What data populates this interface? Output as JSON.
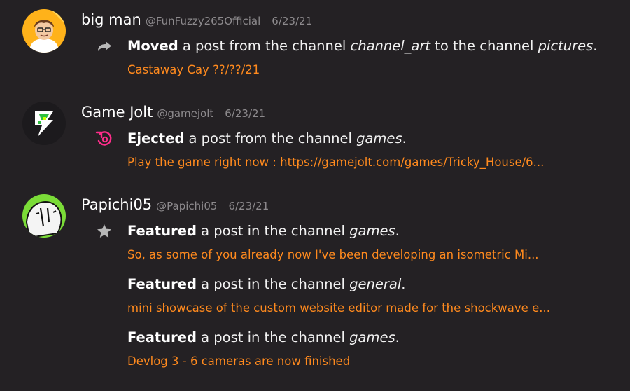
{
  "colors": {
    "background": "#242124",
    "link": "#ff8a1e",
    "muted": "#8d8a8d",
    "ejected_icon": "#ff2d8a",
    "icon_gray": "#b8b8b8"
  },
  "entries": [
    {
      "user": {
        "name": "big man",
        "handle": "@FunFuzzy265Official",
        "date": "6/23/21"
      },
      "actions": [
        {
          "icon": "moved-arrow-icon",
          "verb": "Moved",
          "text1": " a post from the channel ",
          "channel1": "channel_art",
          "text2": " to the channel ",
          "channel2": "pictures",
          "text3": ".",
          "link": "Castaway Cay ??/??/21"
        }
      ]
    },
    {
      "user": {
        "name": "Game Jolt",
        "handle": "@gamejolt",
        "date": "6/23/21"
      },
      "actions": [
        {
          "icon": "ejected-icon",
          "verb": "Ejected",
          "text1": " a post from the channel ",
          "channel1": "games",
          "text3": ".",
          "link": "Play the game right now : https://gamejolt.com/games/Tricky_House/6..."
        }
      ]
    },
    {
      "user": {
        "name": "Papichi05",
        "handle": "@Papichi05",
        "date": "6/23/21"
      },
      "actions": [
        {
          "icon": "star-icon",
          "verb": "Featured",
          "text1": " a post in the channel ",
          "channel1": "games",
          "text3": ".",
          "link": "So, as some of you already now I've been developing an isometric Mi..."
        },
        {
          "verb": "Featured",
          "text1": " a post in the channel ",
          "channel1": "general",
          "text3": ".",
          "link": "mini showcase of the custom website editor made for the shockwave e..."
        },
        {
          "verb": "Featured",
          "text1": " a post in the channel ",
          "channel1": "games",
          "text3": ".",
          "link": "Devlog 3 - 6 cameras are now finished"
        }
      ]
    }
  ]
}
